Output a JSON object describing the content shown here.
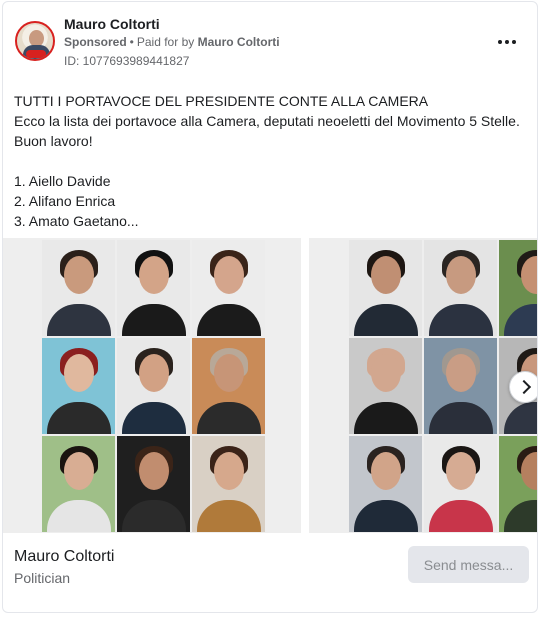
{
  "ad": {
    "advertiser": "Mauro Coltorti",
    "sponsored": "Sponsored",
    "paid_for_by_label": "Paid for by",
    "paid_for_by_name": "Mauro Coltorti",
    "library_id": "ID: 1077693989441827"
  },
  "body": {
    "lines": [
      "TUTTI I PORTAVOCE DEL PRESIDENTE CONTE ALLA CAMERA",
      "Ecco la lista dei portavoce alla Camera, deputati neoeletti del Movimento 5 Stelle.",
      "Buon lavoro!",
      "",
      "1. Aiello Davide",
      "2. Alifano Enrica",
      "3. Amato Gaetano..."
    ]
  },
  "carousel": {
    "slides": [
      {
        "photos": [
          {
            "skin": "#c99a7d",
            "hair": "#2b201a",
            "shirt": "#2e3440",
            "bg": "#e9e9e9"
          },
          {
            "skin": "#d3a488",
            "hair": "#111111",
            "shirt": "#1a1a1a",
            "bg": "#e9e9e9"
          },
          {
            "skin": "#d4a58c",
            "hair": "#3a2419",
            "shirt": "#1b1b1b",
            "bg": "#ececec"
          },
          {
            "skin": "#e0b89e",
            "hair": "#8b1f1f",
            "shirt": "#2a2a2a",
            "bg": "#7fc3d6"
          },
          {
            "skin": "#d2a184",
            "hair": "#2a221d",
            "shirt": "#1e2d3f",
            "bg": "#e8e8e8"
          },
          {
            "skin": "#c79577",
            "hair": "#b8a898",
            "shirt": "#2b2b2b",
            "bg": "#c98b58"
          },
          {
            "skin": "#d8ad93",
            "hair": "#1a1410",
            "shirt": "#e5e5e5",
            "bg": "#9fbf88"
          },
          {
            "skin": "#c18d6f",
            "hair": "#3b2418",
            "shirt": "#2b2b2b",
            "bg": "#1f1f1f"
          },
          {
            "skin": "#d6a88c",
            "hair": "#3b2318",
            "shirt": "#b07a3a",
            "bg": "#d9d0c5"
          }
        ]
      },
      {
        "photos": [
          {
            "skin": "#c08f73",
            "hair": "#1d1612",
            "shirt": "#222a35",
            "bg": "#e6e6e6"
          },
          {
            "skin": "#c79a80",
            "hair": "#2a2522",
            "shirt": "#2b3240",
            "bg": "#e4e4e4"
          },
          {
            "skin": "#c59072",
            "hair": "#1f1a16",
            "shirt": "#2d3b52",
            "bg": "#6b8e4e"
          },
          {
            "skin": "#d2a78f",
            "hair": "#d2a78f",
            "shirt": "#1a1a1a",
            "bg": "#c9c9c9"
          },
          {
            "skin": "#c99d85",
            "hair": "#a09890",
            "shirt": "#2a2f3a",
            "bg": "#7f93a5"
          },
          {
            "skin": "#c8977c",
            "hair": "#1f1a16",
            "shirt": "#2f3542",
            "bg": "#b7b7b7"
          },
          {
            "skin": "#d1a489",
            "hair": "#2a2320",
            "shirt": "#1f2a38",
            "bg": "#c2c6cc"
          },
          {
            "skin": "#d6ab93",
            "hair": "#1a1614",
            "shirt": "#c8354a",
            "bg": "#e9e9e9"
          },
          {
            "skin": "#b5805f",
            "hair": "#2a1c14",
            "shirt": "#2d3a2a",
            "bg": "#7aa05b"
          }
        ]
      }
    ]
  },
  "footer": {
    "page_name": "Mauro Coltorti",
    "category": "Politician",
    "cta_label": "Send messa..."
  }
}
